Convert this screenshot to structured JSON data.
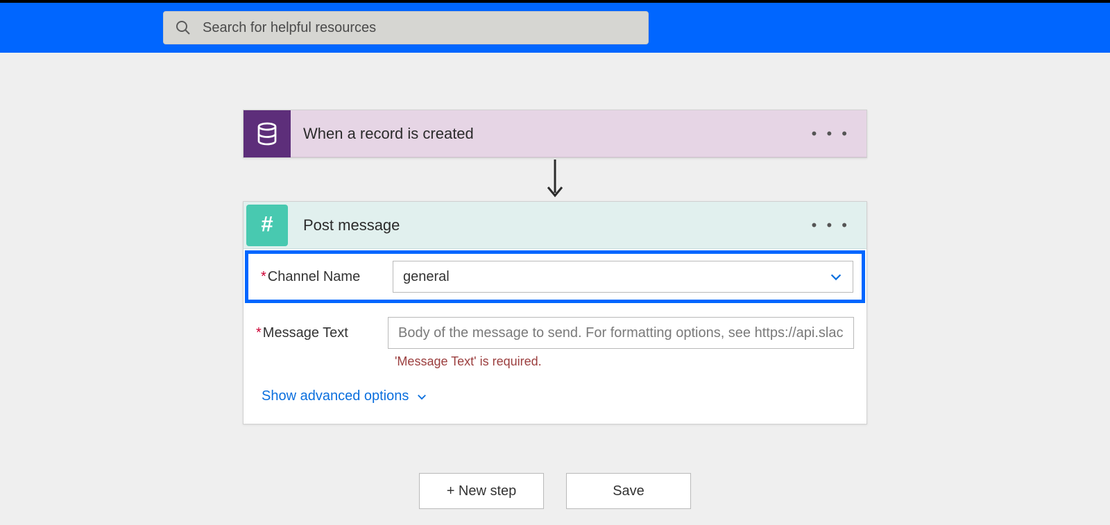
{
  "topbar": {
    "search_placeholder": "Search for helpful resources"
  },
  "trigger": {
    "title": "When a record is created",
    "icon_name": "database-icon",
    "color": "#5d2e7a"
  },
  "action": {
    "title": "Post message",
    "icon_name": "slack-hash-icon",
    "color": "#48c9b0",
    "fields": {
      "channel": {
        "label": "Channel Name",
        "required": true,
        "value": "general"
      },
      "message": {
        "label": "Message Text",
        "required": true,
        "placeholder": "Body of the message to send. For formatting options, see https://api.slack.com/",
        "error": "'Message Text' is required."
      }
    },
    "advanced_label": "Show advanced options"
  },
  "footer": {
    "new_step_label": "+ New step",
    "save_label": "Save"
  },
  "ui": {
    "more": "• • •",
    "asterisk": "*"
  }
}
